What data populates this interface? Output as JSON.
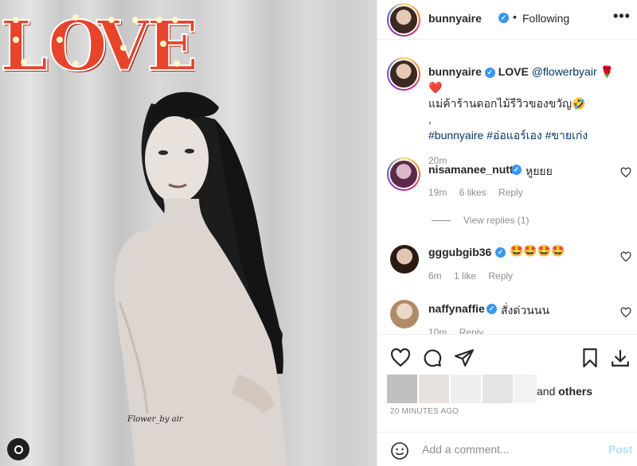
{
  "photo": {
    "sign_text": "LOVE",
    "watermark": "Flower_by air"
  },
  "header": {
    "username": "bunnyaire",
    "separator": "•",
    "follow_status": "Following",
    "more": "•••"
  },
  "caption": {
    "username": "bunnyaire",
    "line1_bold": "LOVE",
    "mention": "@flowerbyair",
    "emoji": "🌹❤️",
    "line2": "แม่ค้าร้านดอกไม้รีวิวของขวัญ🤣",
    "comma": ",",
    "hashtags": [
      "#bunnyaire",
      "#อ่อแอร์เอง",
      "#ขายเก่ง"
    ],
    "time": "20m"
  },
  "comments": [
    {
      "username": "nisamanee_nutt",
      "text": "หูยยย",
      "time": "19m",
      "likes": "6 likes",
      "reply": "Reply"
    },
    {
      "username": "gggubgib36",
      "text": "🤩🤩🤩🤩",
      "time": "6m",
      "likes": "1 like",
      "reply": "Reply"
    },
    {
      "username": "naffynaffie",
      "text": "สั่งด่วนนน",
      "time": "10m",
      "likes": "",
      "reply": "Reply"
    }
  ],
  "view_replies": "View replies (1)",
  "likes": {
    "and": "and",
    "others": "others"
  },
  "timestamp": "20 MINUTES AGO",
  "add_comment": {
    "placeholder": "Add a comment...",
    "post": "Post"
  },
  "colors": {
    "verified": "#3897f0",
    "link": "#00376b",
    "post_disabled": "#b2dffc",
    "sign": "#e8432b"
  }
}
